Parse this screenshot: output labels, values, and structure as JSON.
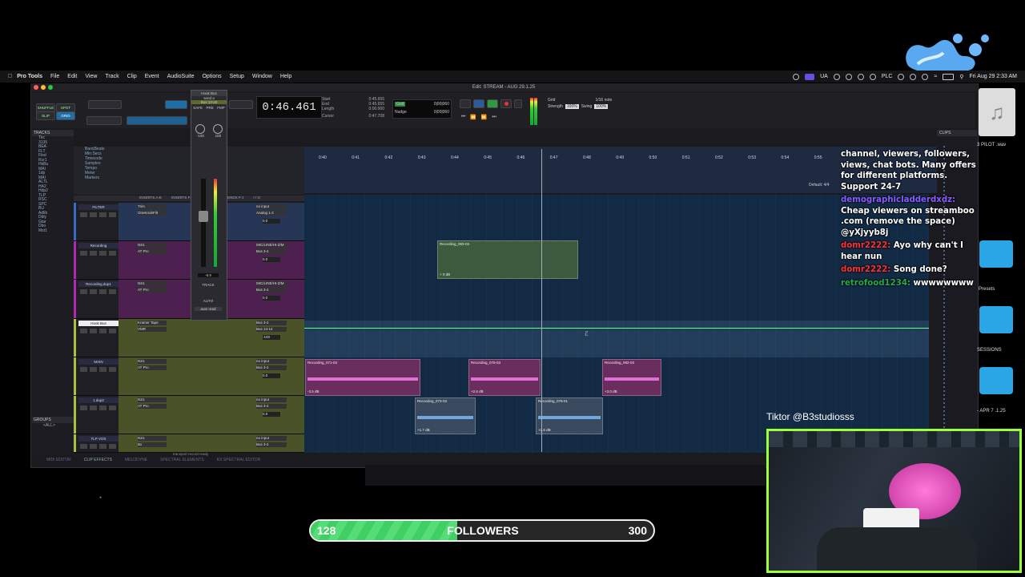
{
  "menubar": {
    "app": "Pro Tools",
    "items": [
      "File",
      "Edit",
      "View",
      "Track",
      "Clip",
      "Event",
      "AudioSuite",
      "Options",
      "Setup",
      "Window",
      "Help"
    ],
    "right": {
      "lang": "UA",
      "plc": "PLC",
      "datetime": "Fri Aug 29  2:33 AM"
    }
  },
  "window": {
    "title": "Edit: STREAM - AUG 29.1.25"
  },
  "toolbar": {
    "modes": [
      "SHUFFLE",
      "SPOT",
      "SLIP",
      "GRID"
    ],
    "counter": "0:46.461",
    "start_label": "Start",
    "end_label": "End",
    "length_label": "Length",
    "start": "0:45.655",
    "end": "0:45.655",
    "length": "0:00.000",
    "cursor_label": "Cursor",
    "cursor": "0:47.708",
    "grid_label": "Grid",
    "nudge_label": "Nudge",
    "grid_value": "0|00|060",
    "nudge_value": "0|00|060",
    "quant": "1/16 note",
    "strength_label": "Strength",
    "strength": "100%",
    "swing_label": "Swing",
    "swing": "100%"
  },
  "tracks_panel": {
    "header": "TRACKS",
    "items": [
      "Tkc",
      "3135",
      "BEA",
      "FLT",
      "Flod",
      "Rcr1",
      "HkBu",
      "MAI",
      "1dp",
      "MAI",
      "ALTL",
      "HA2",
      "Hdp2",
      "TLP",
      "RSC",
      "SPC",
      "BU",
      "Adlib",
      "Dbly",
      "Gtar",
      "Dbo",
      "Mst1"
    ]
  },
  "groups_panel": {
    "header": "GROUPS",
    "item": "<ALL>"
  },
  "ruler_labels": [
    "Bars|Beats",
    "Min:Secs",
    "Timecode",
    "Samples",
    "Tempo",
    "Meter",
    "Markers"
  ],
  "timeline_ticks": [
    "0:40",
    "0:41",
    "0:42",
    "0:43",
    "0:44",
    "0:45",
    "0:46",
    "0:47",
    "0:48",
    "0:49",
    "0:50",
    "0:51",
    "0:52",
    "0:53",
    "0:54",
    "0:55"
  ],
  "ruler_default": "Default: 4/4",
  "columns": {
    "inserts_ae": "INSERTS A-E",
    "inserts_fj": "INSERTS F-J",
    "sends": "SENDS F-J",
    "io": "I / O"
  },
  "tracks": [
    {
      "name": "FILTER",
      "color": "#3a6cc6",
      "ins1": "Trim",
      "ins2": "OneKnobFilt",
      "io1": "no input",
      "io2": "Analog 1-2",
      "vol": "0.0"
    },
    {
      "name": "Recording",
      "color": "#b02ab0",
      "ins1": "NS1",
      "ins2": "AT Pro",
      "io1": "MIC/LINE/HI-Z/M",
      "io2": "Bus 3-4",
      "vol": "0.0"
    },
    {
      "name": "Recording.dup1",
      "color": "#b02ab0",
      "ins1": "NS1",
      "ins2": "AT Pro",
      "io1": "MIC/LINE/HI-Z/M",
      "io2": "Bus 3-4",
      "vol": "0.0"
    },
    {
      "name": "Hook Bus",
      "color": "#a8c23a",
      "ins1": "Kramer Tape",
      "ins2": "VMR",
      "io1": "Bus 3-4",
      "io2": "Bus 13-14",
      "vol": "-100"
    },
    {
      "name": "MAIN",
      "color": "#a8c23a",
      "ins1": "NS1",
      "ins2": "AT Pro",
      "io1": "no input",
      "io2": "Bus 3-4",
      "vol": "0.0"
    },
    {
      "name": "1.dup2",
      "color": "#a8c23a",
      "ins1": "NS1",
      "ins2": "AT Pro",
      "io1": "no input",
      "io2": "Bus 3-4",
      "vol": "0.0"
    },
    {
      "name": "TLP VOX",
      "color": "#a8c23a",
      "ins1": "NS1",
      "ins2": "Bx",
      "io1": "no input",
      "io2": "Bus 3-4",
      "vol": "0.0"
    }
  ],
  "regions": [
    {
      "name": "Recording_083-03",
      "gain": "+ 0 dB"
    },
    {
      "name": "Recording_071-03",
      "gain": "-3.5 dB"
    },
    {
      "name": "Recording_075-03",
      "gain": "+2.6 dB"
    },
    {
      "name": "Recording_082-03",
      "gain": "+3.0 dB"
    },
    {
      "name": "Recording_073-03",
      "gain": "+1.7 dB"
    },
    {
      "name": "Recording_079-01",
      "gain": "+2.6 dB"
    }
  ],
  "mixer_strip": {
    "name": "Hook Bus",
    "insert": "send a",
    "bus": "Bus 13-20",
    "safe": "SAFE",
    "pre": "PRE",
    "fmp": "FMP",
    "vol": "-100",
    "pan": "100",
    "level": "-8.9",
    "track": "TRACK",
    "auto": "AUTO",
    "auto_mode": "auto read"
  },
  "bottom_tabs": [
    "MIDI EDITOR",
    "CLIP EFFECTS",
    "MELODYNE",
    "SPECTRAL ELEMENTS",
    "RX SPECTRAL EDITOR"
  ],
  "status_text": "transport record ready",
  "clips_panel": {
    "header": "CLIPS"
  },
  "finder": {
    "file1": "3 PILOT .wav",
    "presets": "Presets",
    "sessions": "SESSIONS",
    "date": "- APR 7 .1.25"
  },
  "chat": [
    {
      "user": "",
      "text": "channel, viewers, followers, views, chat bots. Many offers for different platforms. Support 24-7"
    },
    {
      "user": "demographicladderdxdz:",
      "text": "Cheap viewers on streamboo .com (remove the space) @yXjyyb8j"
    },
    {
      "user": "domr2222:",
      "text": "Ayo why can't I hear nun"
    },
    {
      "user": "domr2222:",
      "text": "Song done?"
    },
    {
      "user": "retrofood1234:",
      "text": "wwwwwwww"
    }
  ],
  "overlay": {
    "tiktok": "Tiktor @B3studiosss"
  },
  "followers": {
    "current": 128,
    "label": "FOLLOWERS",
    "goal": 300,
    "progress": 0.427
  },
  "colors": {
    "accent_green": "#9bff3a",
    "follow_fill": "#3fcf63",
    "logo": "#5aa8f0"
  },
  "icons": [
    "apple-icon",
    "play-icon",
    "stop-icon",
    "record-icon",
    "rewind-icon",
    "fast-forward-icon",
    "wifi-icon",
    "battery-icon",
    "search-icon",
    "music-file-icon",
    "folder-icon"
  ]
}
